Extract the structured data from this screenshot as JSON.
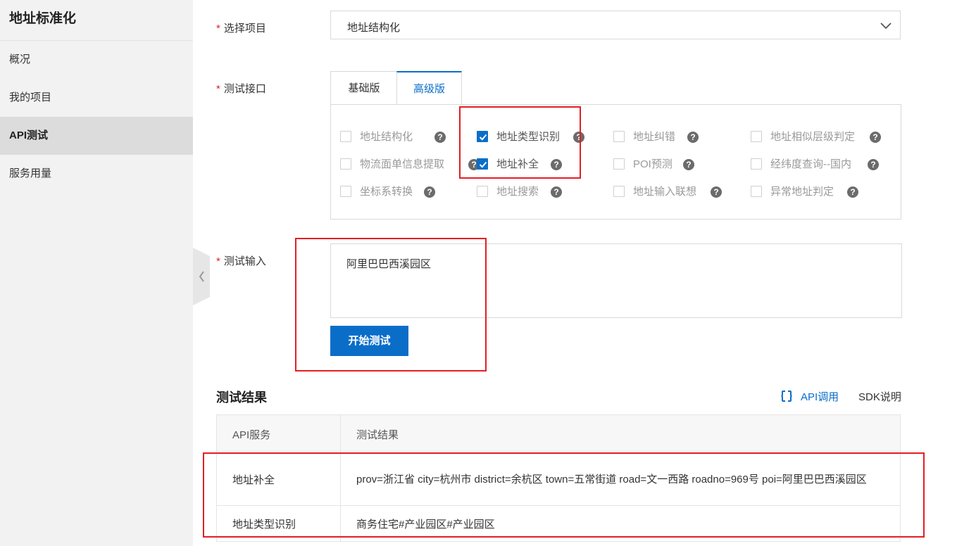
{
  "sidebar": {
    "title": "地址标准化",
    "items": [
      {
        "label": "概况"
      },
      {
        "label": "我的项目"
      },
      {
        "label": "API测试"
      },
      {
        "label": "服务用量"
      }
    ]
  },
  "form": {
    "required_mark": "*",
    "project_label": "选择项目",
    "project_value": "地址结构化",
    "interface_label": "测试接口",
    "tabs": [
      {
        "label": "基础版"
      },
      {
        "label": "高级版",
        "active": true
      }
    ],
    "options": [
      {
        "label": "地址结构化",
        "checked": false
      },
      {
        "label": "地址类型识别",
        "checked": true
      },
      {
        "label": "地址纠错",
        "checked": false
      },
      {
        "label": "地址相似层级判定",
        "checked": false
      },
      {
        "label": "物流面单信息提取",
        "checked": false
      },
      {
        "label": "地址补全",
        "checked": true
      },
      {
        "label": "POI预测",
        "checked": false
      },
      {
        "label": "经纬度查询--国内",
        "checked": false
      },
      {
        "label": "坐标系转换",
        "checked": false
      },
      {
        "label": "地址搜索",
        "checked": false
      },
      {
        "label": "地址输入联想",
        "checked": false
      },
      {
        "label": "异常地址判定",
        "checked": false
      }
    ],
    "help_glyph": "?",
    "input_label": "测试输入",
    "input_value": "阿里巴巴西溪园区",
    "start_button": "开始测试"
  },
  "results": {
    "title": "测试结果",
    "api_call_link": "API调用",
    "sdk_link": "SDK说明",
    "columns": [
      "API服务",
      "测试结果"
    ],
    "rows": [
      {
        "service": "地址补全",
        "result": "prov=浙江省 city=杭州市 district=余杭区 town=五常街道 road=文一西路 roadno=969号 poi=阿里巴巴西溪园区"
      },
      {
        "service": "地址类型识别",
        "result": "商务住宅#产业园区#产业园区"
      }
    ]
  },
  "colors": {
    "accent": "#0a6ec9",
    "required": "#e0202a",
    "annotation": "#e31e24",
    "sidebar_bg": "#f2f2f2"
  }
}
